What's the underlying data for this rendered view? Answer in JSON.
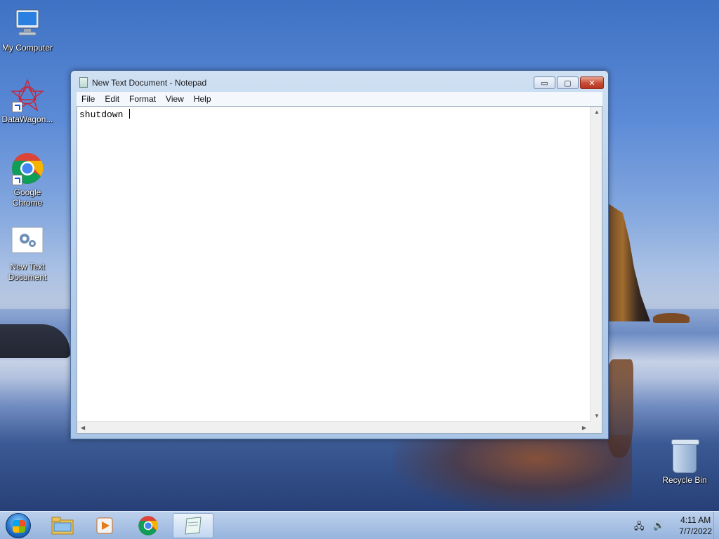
{
  "desktop": {
    "icons": [
      {
        "label": "My Computer"
      },
      {
        "label": "DataWagon..."
      },
      {
        "label": "Google Chrome"
      },
      {
        "label": "New Text Document"
      }
    ],
    "recycle_bin": {
      "label": "Recycle Bin"
    }
  },
  "window": {
    "title": "New Text Document - Notepad",
    "caption_buttons": {
      "minimize": "▭",
      "maximize": "▢",
      "close": "✕"
    },
    "menu": [
      "File",
      "Edit",
      "Format",
      "View",
      "Help"
    ],
    "content": "shutdown "
  },
  "taskbar": {
    "apps": [
      "file-explorer-icon",
      "media-player-icon",
      "chrome-icon",
      "notepad-icon"
    ],
    "clock_time": "4:11 AM",
    "clock_date": "7/7/2022"
  },
  "colors": {
    "accent": "#1c5ad6",
    "close": "#c74b35"
  }
}
